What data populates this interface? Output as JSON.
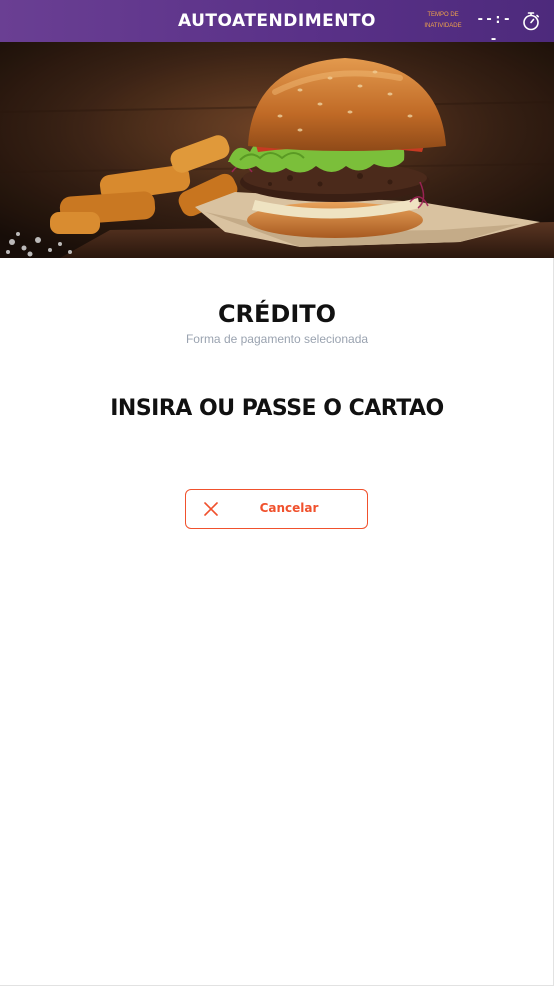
{
  "header": {
    "title": "AUTOATENDIMENTO",
    "inactivity_label_line1": "TEMPO DE",
    "inactivity_label_line2": "INATIVIDADE",
    "timer_value": "--:--",
    "icon": "stopwatch-icon",
    "background_color": "#5a3188",
    "label_color": "#f0a34a"
  },
  "hero": {
    "icon": "burger-image"
  },
  "payment": {
    "method": "CRÉDITO",
    "subtitle": "Forma de pagamento selecionada",
    "instruction": "INSIRA OU PASSE O CARTAO"
  },
  "cancel_button": {
    "label": "Cancelar",
    "icon": "close-icon",
    "color": "#f0512d"
  }
}
